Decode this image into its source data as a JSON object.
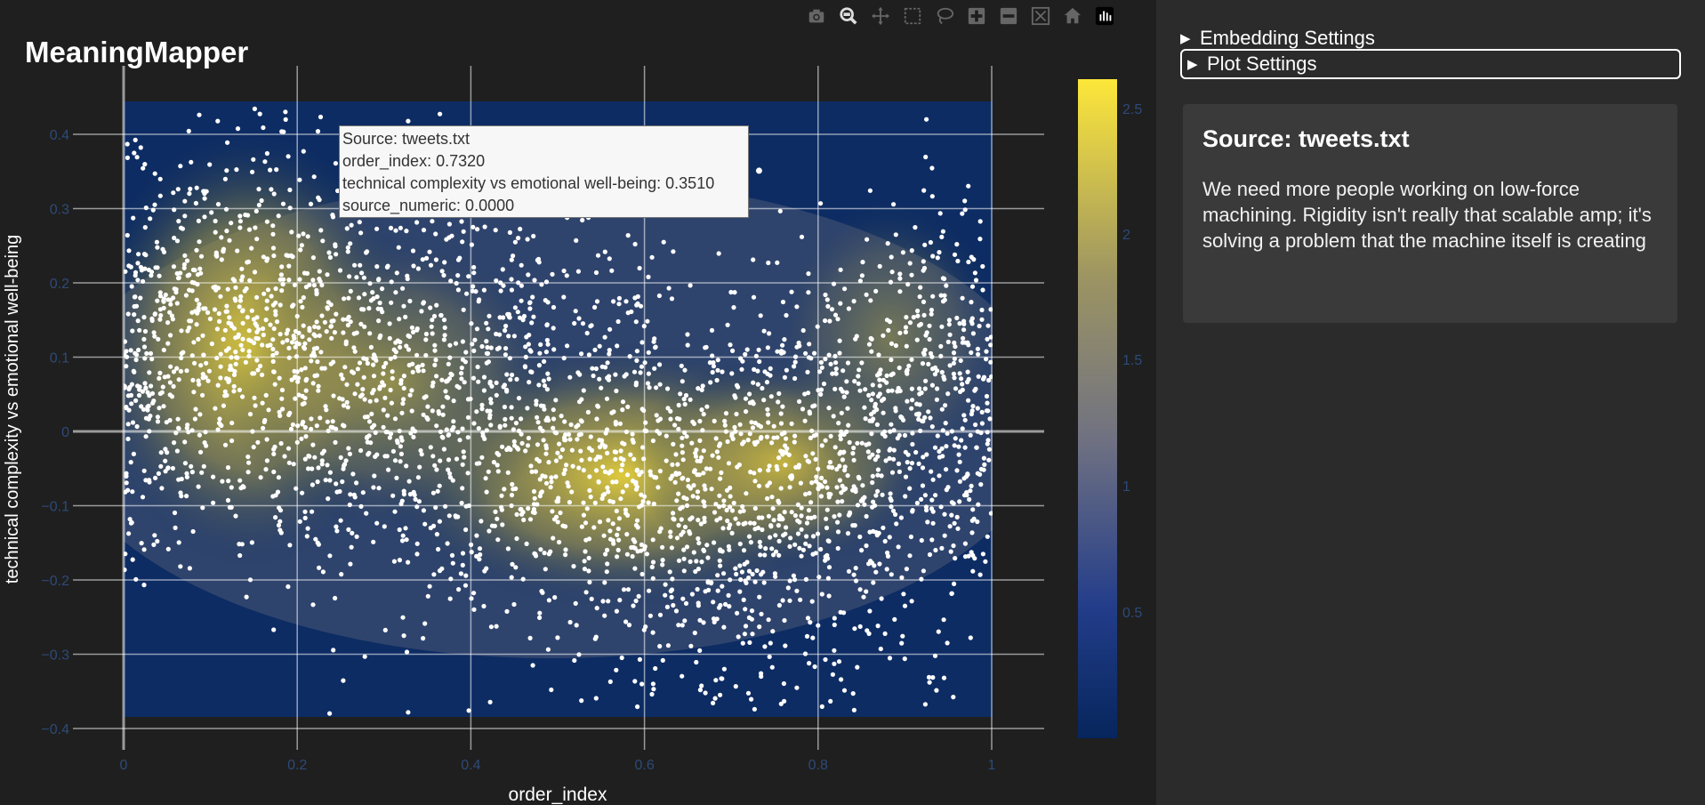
{
  "app": {
    "title": "MeaningMapper"
  },
  "modebar": {
    "buttons": [
      {
        "name": "camera-icon"
      },
      {
        "name": "zoom-icon"
      },
      {
        "name": "pan-icon"
      },
      {
        "name": "box-select-icon"
      },
      {
        "name": "lasso-select-icon"
      },
      {
        "name": "zoom-in-icon"
      },
      {
        "name": "zoom-out-icon"
      },
      {
        "name": "autoscale-icon"
      },
      {
        "name": "reset-axes-icon"
      },
      {
        "name": "plotly-logo-icon"
      }
    ]
  },
  "sidebar": {
    "embedding_settings_label": "Embedding Settings",
    "plot_settings_label": "Plot Settings",
    "source_title": "Source: tweets.txt",
    "source_text": "We need more people working on low-force machining. Rigidity isn't really that scalable amp; it's solving a problem that the machine itself is creating"
  },
  "tooltip": {
    "line1": "Source: tweets.txt",
    "line2": "order_index: 0.7320",
    "line3": "technical complexity vs emotional well-being: 0.3510",
    "line4": "source_numeric: 0.0000"
  },
  "chart_data": {
    "type": "scatter",
    "xlabel": "order_index",
    "ylabel": "technical complexity vs emotional well-being",
    "xlim": [
      0,
      1
    ],
    "ylim": [
      -0.4,
      0.4
    ],
    "x_ticks": [
      "0",
      "0.2",
      "0.4",
      "0.6",
      "0.8",
      "1"
    ],
    "y_ticks": [
      "0.4",
      "0.3",
      "0.2",
      "0.1",
      "0",
      "−0.1",
      "−0.2",
      "−0.3",
      "−0.4"
    ],
    "colorbar_ticks": [
      "2.5",
      "2",
      "1.5",
      "1",
      "0.5"
    ],
    "colorscale": [
      "#08306b",
      "#1f3d8a",
      "#7a7a7a",
      "#c9b53a",
      "#ffe93a"
    ],
    "grid": true,
    "density_overlay": true,
    "highlighted_point": {
      "x": 0.732,
      "y": 0.351
    },
    "series": [
      {
        "n_points": 3200,
        "x_range": [
          0,
          1
        ],
        "y_range": [
          -0.38,
          0.44
        ],
        "color": "#ffffff"
      }
    ]
  }
}
